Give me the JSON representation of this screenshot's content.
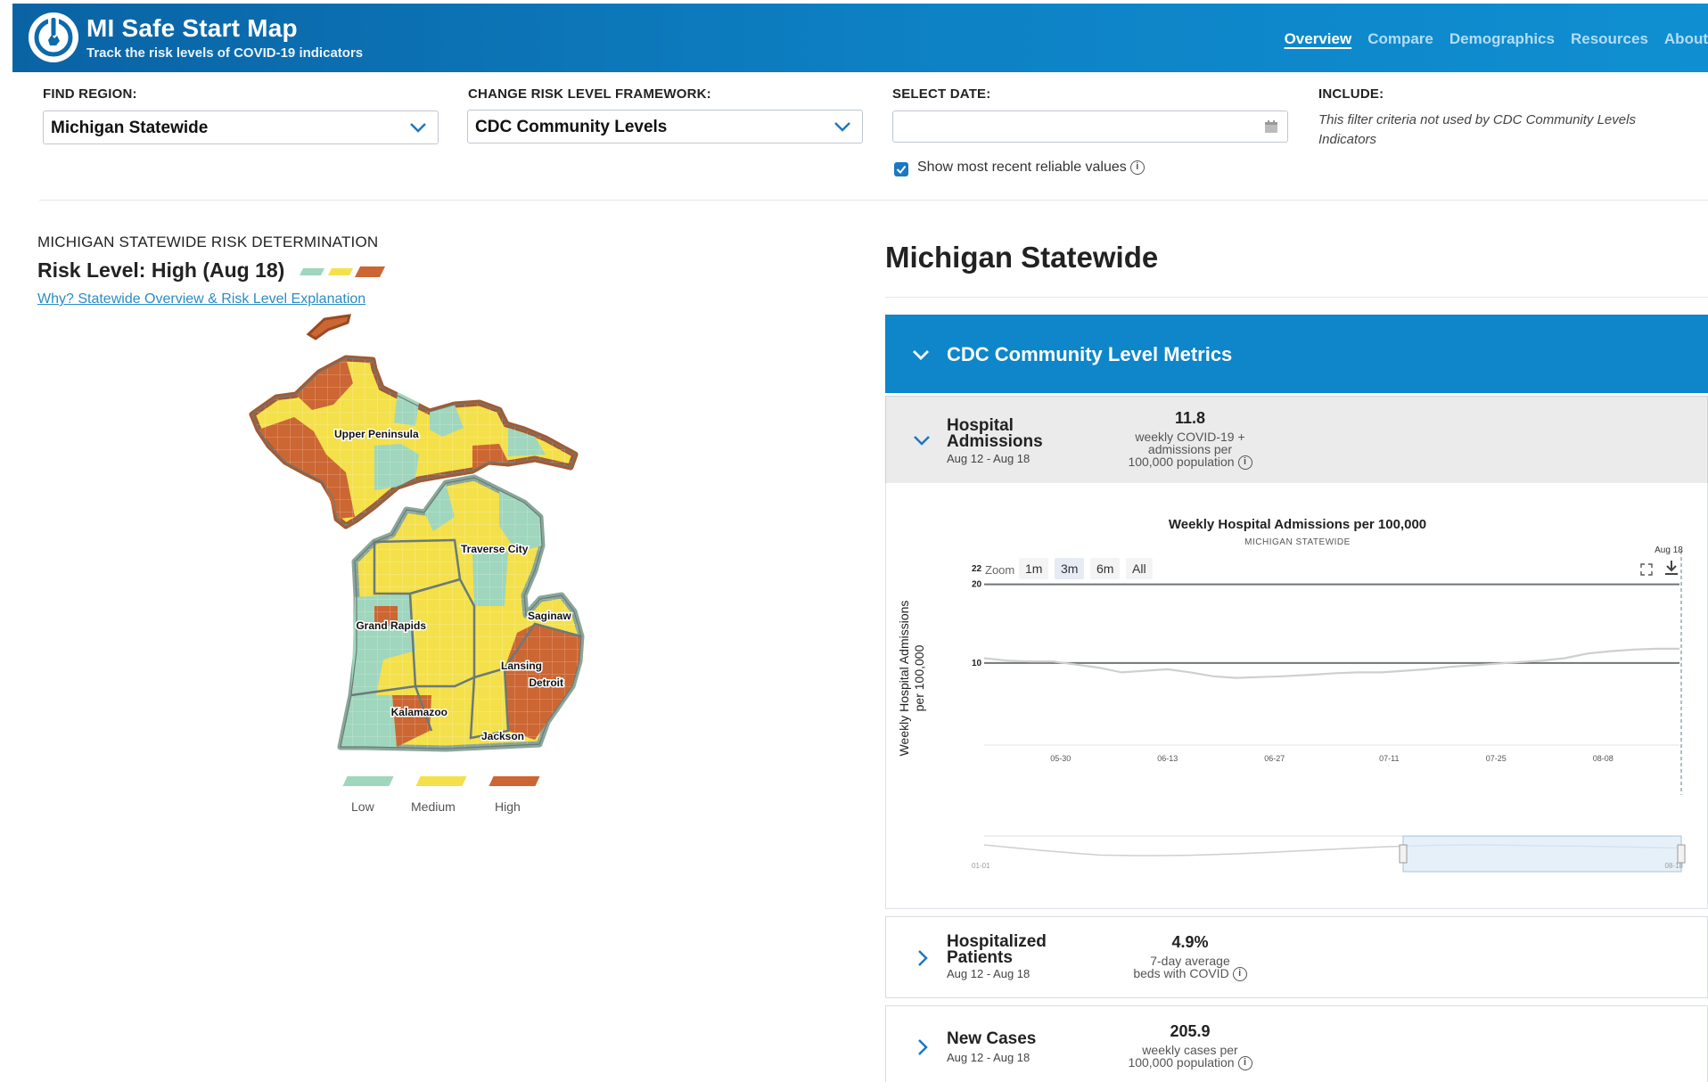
{
  "header": {
    "title": "MI Safe Start Map",
    "subtitle": "Track the risk levels of COVID-19 indicators",
    "nav": [
      {
        "label": "Overview",
        "active": true
      },
      {
        "label": "Compare"
      },
      {
        "label": "Demographics"
      },
      {
        "label": "Resources"
      },
      {
        "label": "About"
      }
    ],
    "accent_color": "#0d82c5"
  },
  "filters": {
    "region_label": "FIND REGION:",
    "region_value": "Michigan Statewide",
    "framework_label": "CHANGE RISK LEVEL FRAMEWORK:",
    "framework_value": "CDC Community Levels",
    "date_label": "SELECT DATE:",
    "date_value": "",
    "recent_label": "Show most recent reliable values",
    "recent_checked": true,
    "include_label": "INCLUDE:",
    "include_note": "This filter criteria not used by CDC Community Levels Indicators"
  },
  "risk": {
    "heading": "MICHIGAN STATEWIDE RISK DETERMINATION",
    "level_text": "Risk Level: High (Aug 18)",
    "link_text": "Why? Statewide Overview & Risk Level Explanation",
    "colors": {
      "low": "#9fd6bd",
      "medium": "#f4e04a",
      "high": "#cc6633"
    }
  },
  "map": {
    "labels": [
      "Upper Peninsula",
      "Traverse City",
      "Grand Rapids",
      "Saginaw",
      "Lansing",
      "Detroit",
      "Kalamazoo",
      "Jackson"
    ],
    "legend": [
      "Low",
      "Medium",
      "High"
    ]
  },
  "detail": {
    "region_title": "Michigan Statewide",
    "section_title": "CDC Community Level Metrics",
    "metrics": [
      {
        "name_line1": "Hospital",
        "name_line2": "Admissions",
        "dates": "Aug 12 - Aug 18",
        "value": "11.8",
        "desc_line1": "weekly COVID-19 +",
        "desc_line2": "admissions per",
        "desc_line3": "100,000 population"
      },
      {
        "name_line1": "Hospitalized",
        "name_line2": "Patients",
        "dates": "Aug 12 - Aug 18",
        "value": "4.9%",
        "desc_line1": "7-day average",
        "desc_line2": "beds with COVID"
      },
      {
        "name_line1": "New Cases",
        "dates": "Aug 12 - Aug 18",
        "value": "205.9",
        "desc_line1": "weekly cases per",
        "desc_line2": "100,000 population"
      }
    ]
  },
  "chart": {
    "title": "Weekly Hospital Admissions per 100,000",
    "subtitle": "MICHIGAN STATEWIDE",
    "ylabel_line1": "Weekly Hospital Admissions",
    "ylabel_line2": "per 100,000",
    "zoom_label": "Zoom",
    "zoom_options": [
      "1m",
      "3m",
      "6m",
      "All"
    ],
    "zoom_selected": "3m",
    "last_date_label": "Aug 18",
    "nav_start_label": "01-01",
    "nav_end_label": "08-18"
  },
  "chart_data": {
    "type": "line",
    "x_ticks": [
      "05-30",
      "06-13",
      "06-27",
      "07-11",
      "07-25",
      "08-08"
    ],
    "y_ticks": [
      10,
      20,
      22
    ],
    "thresholds": [
      10,
      20
    ],
    "ylim": [
      0,
      22
    ],
    "series": [
      {
        "x": [
          "05-20",
          "05-23",
          "05-26",
          "05-29",
          "06-01",
          "06-04",
          "06-07",
          "06-10",
          "06-13",
          "06-16",
          "06-19",
          "06-22",
          "06-25",
          "06-28",
          "07-01",
          "07-04",
          "07-07",
          "07-10",
          "07-13",
          "07-16",
          "07-19",
          "07-22",
          "07-25",
          "07-28",
          "07-31",
          "08-03",
          "08-06",
          "08-09",
          "08-12",
          "08-15",
          "08-18"
        ],
        "values": [
          10.6,
          10.3,
          10.2,
          10.2,
          9.8,
          9.4,
          8.8,
          9.0,
          9.2,
          8.8,
          8.3,
          8.1,
          8.2,
          8.3,
          8.5,
          8.7,
          8.8,
          8.8,
          9.0,
          9.2,
          9.5,
          9.7,
          9.9,
          10.1,
          10.3,
          10.6,
          11.2,
          11.5,
          11.7,
          11.8,
          11.8
        ]
      }
    ]
  }
}
